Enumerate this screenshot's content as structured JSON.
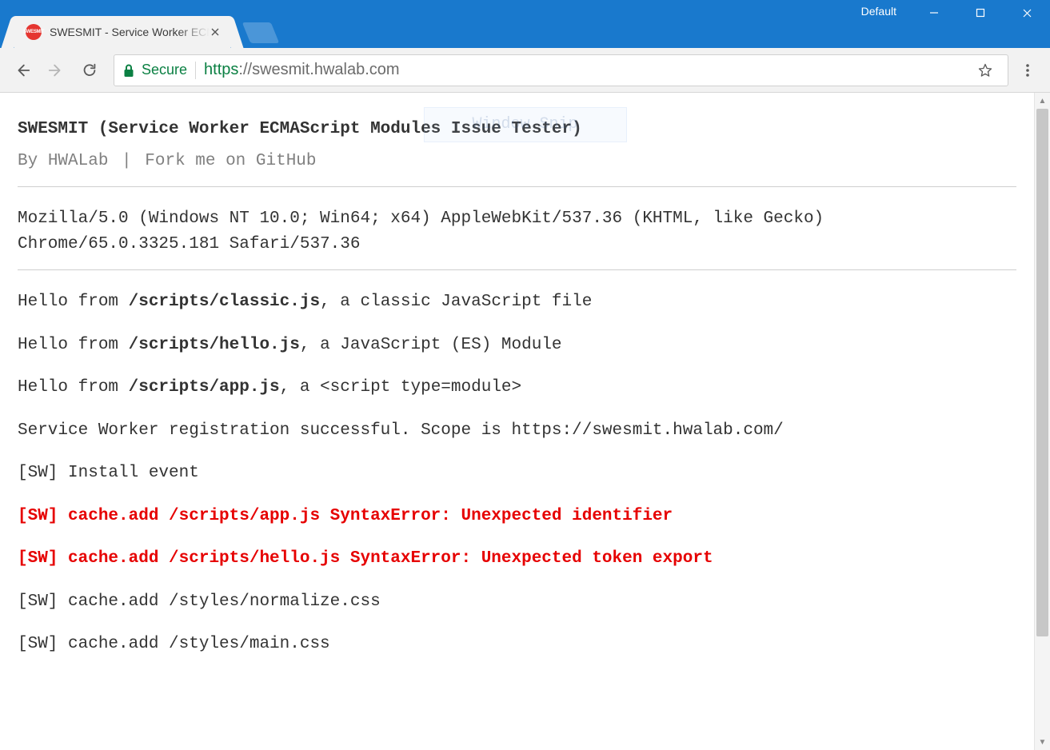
{
  "window": {
    "profile_label": "Default"
  },
  "tab": {
    "title": "SWESMIT - Service Worker ECMAScript Modules Issue Tester",
    "favicon_initials": "SWESMIT"
  },
  "address": {
    "secure_label": "Secure",
    "scheme": "https",
    "host_path": "://swesmit.hwalab.com"
  },
  "snip_overlay": "Window Snip",
  "page": {
    "title": "SWESMIT (Service Worker ECMAScript Modules Issue Tester)",
    "by_prefix": "By ",
    "by_author": "HWALab",
    "fork_label": "Fork me on GitHub",
    "ua": "Mozilla/5.0 (Windows NT 10.0; Win64; x64) AppleWebKit/537.36 (KHTML, like Gecko) Chrome/65.0.3325.181 Safari/537.36",
    "logs": [
      {
        "kind": "hello",
        "prefix": "Hello from ",
        "path": "/scripts/classic.js",
        "suffix": ", a classic JavaScript file"
      },
      {
        "kind": "hello",
        "prefix": "Hello from ",
        "path": "/scripts/hello.js",
        "suffix": ", a JavaScript (ES) Module"
      },
      {
        "kind": "hello_tag",
        "prefix": "Hello from ",
        "path": "/scripts/app.js",
        "mid": ", a ",
        "tag": "<script type=module>"
      },
      {
        "kind": "plain",
        "text": "Service Worker registration successful. Scope is https://swesmit.hwalab.com/"
      },
      {
        "kind": "plain",
        "text": "[SW] Install event"
      },
      {
        "kind": "error",
        "text": "[SW] cache.add /scripts/app.js SyntaxError: Unexpected identifier"
      },
      {
        "kind": "error",
        "text": "[SW] cache.add /scripts/hello.js SyntaxError: Unexpected token export"
      },
      {
        "kind": "plain",
        "text": "[SW] cache.add /styles/normalize.css"
      },
      {
        "kind": "plain",
        "text": "[SW] cache.add /styles/main.css"
      }
    ]
  }
}
